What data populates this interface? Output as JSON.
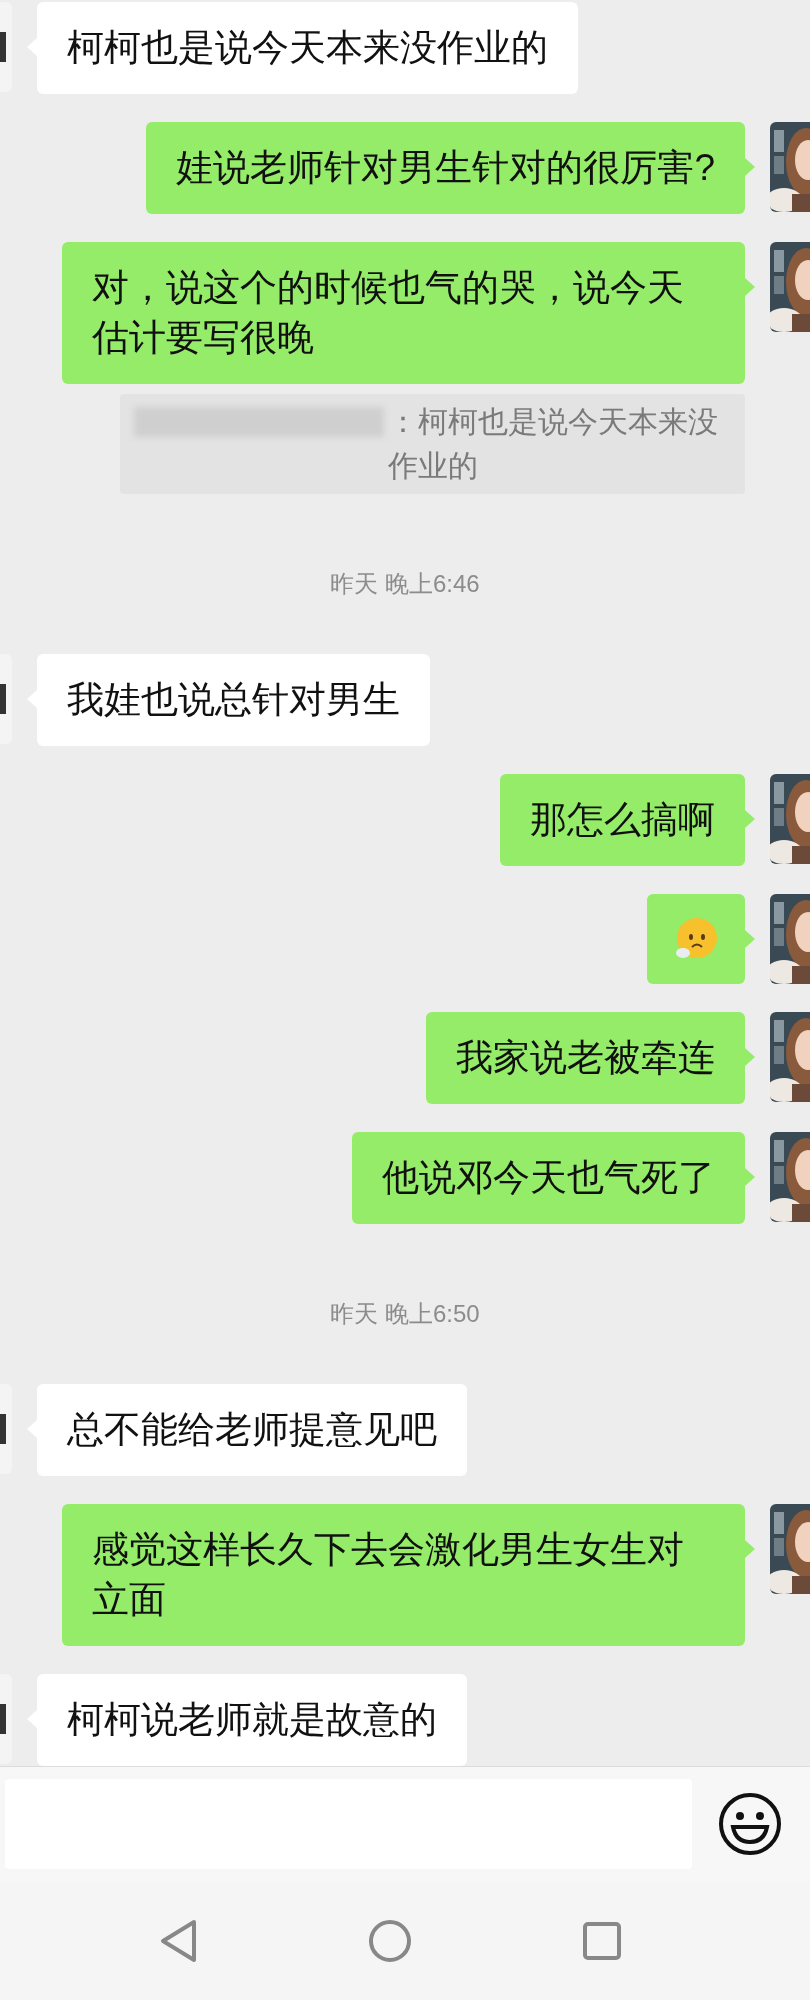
{
  "messages": [
    {
      "kind": "incoming",
      "text": "柯柯也是说今天本来没作业的"
    },
    {
      "kind": "outgoing",
      "text": "娃说老师针对男生针对的很厉害?"
    },
    {
      "kind": "outgoing",
      "text": "对，说这个的时候也气的哭，说今天估计要写很晚",
      "quote": "：柯柯也是说今天本来没作业的"
    },
    {
      "kind": "timestamp",
      "text": "昨天 晚上6:46"
    },
    {
      "kind": "incoming",
      "text": "我娃也说总针对男生"
    },
    {
      "kind": "outgoing",
      "text": "那怎么搞啊"
    },
    {
      "kind": "outgoing_emoji"
    },
    {
      "kind": "outgoing",
      "text": "我家说老被牵连"
    },
    {
      "kind": "outgoing",
      "text": "他说邓今天也气死了"
    },
    {
      "kind": "timestamp",
      "text": "昨天 晚上6:50"
    },
    {
      "kind": "incoming",
      "text": "总不能给老师提意见吧"
    },
    {
      "kind": "outgoing",
      "text": "感觉这样长久下去会激化男生女生对立面"
    },
    {
      "kind": "incoming",
      "text": "柯柯说老师就是故意的"
    }
  ]
}
